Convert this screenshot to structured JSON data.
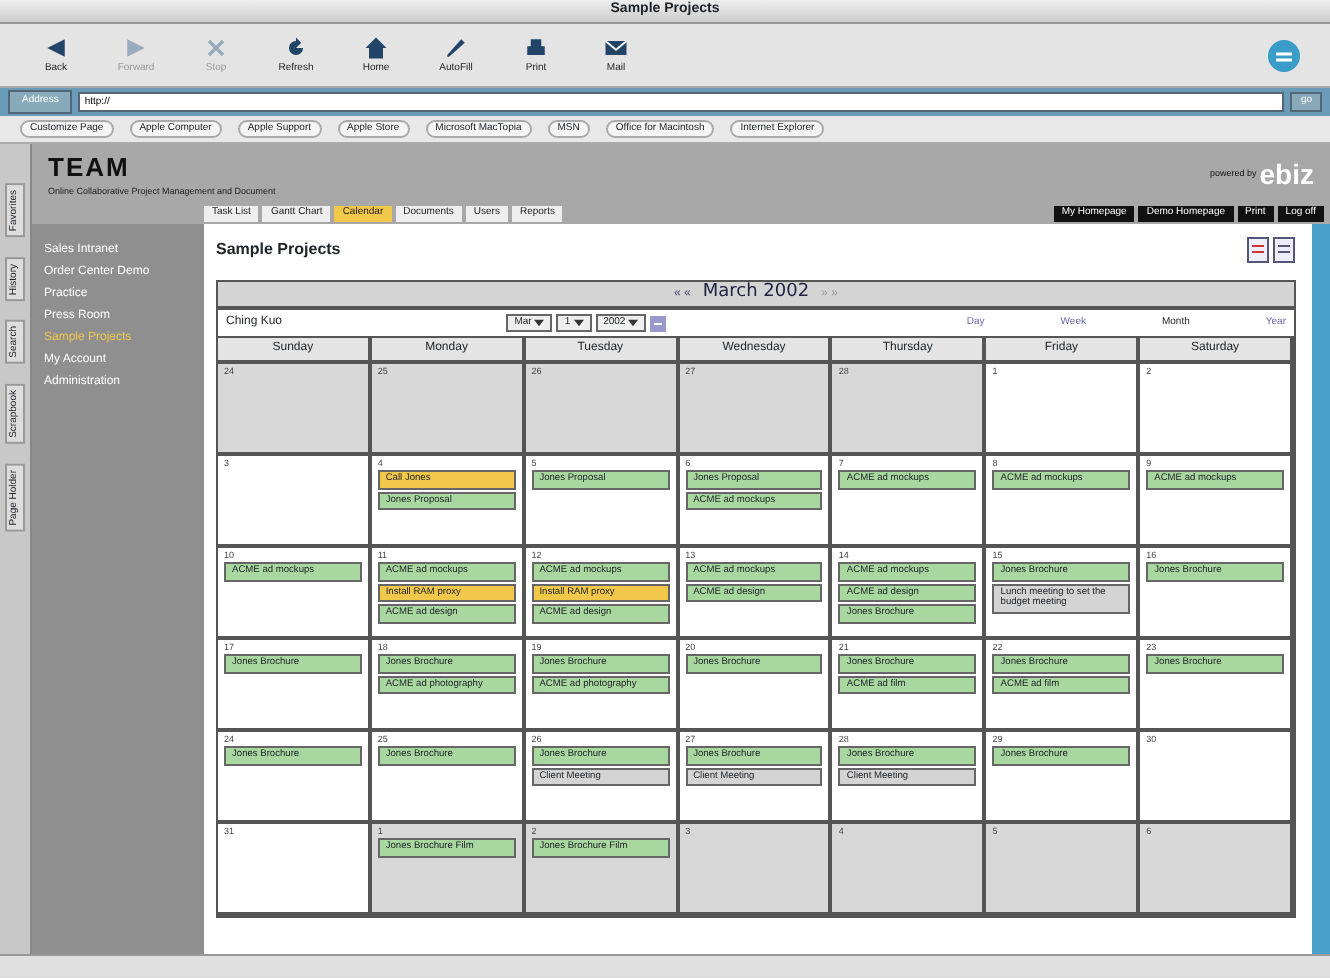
{
  "window": {
    "title": "Sample Projects"
  },
  "toolbar": [
    {
      "label": "Back",
      "disabled": false
    },
    {
      "label": "Forward",
      "disabled": true
    },
    {
      "label": "Stop",
      "disabled": true
    },
    {
      "label": "Refresh",
      "disabled": false
    },
    {
      "label": "Home",
      "disabled": false
    },
    {
      "label": "AutoFill",
      "disabled": false
    },
    {
      "label": "Print",
      "disabled": false
    },
    {
      "label": "Mail",
      "disabled": false
    }
  ],
  "address": {
    "label": "Address",
    "value": "http://",
    "go": "go"
  },
  "favorites": [
    "Customize Page",
    "Apple Computer",
    "Apple Support",
    "Apple Store",
    "Microsoft MacTopia",
    "MSN",
    "Office for Macintosh",
    "Internet Explorer"
  ],
  "explorer_tabs": [
    "Favorites",
    "History",
    "Search",
    "Scrapbook",
    "Page Holder"
  ],
  "header": {
    "logo": "TEAM",
    "tagline": "Online Collaborative Project Management and Document",
    "powered_by": "powered by",
    "brand": "ebiz",
    "links": [
      "My Homepage",
      "Demo Homepage",
      "Print",
      "Log off"
    ]
  },
  "tabs": [
    {
      "label": "Task List",
      "selected": false
    },
    {
      "label": "Gantt Chart",
      "selected": false
    },
    {
      "label": "Calendar",
      "selected": true
    },
    {
      "label": "Documents",
      "selected": false
    },
    {
      "label": "Users",
      "selected": false
    },
    {
      "label": "Reports",
      "selected": false
    }
  ],
  "sidebar": {
    "items": [
      {
        "label": "Sales Intranet",
        "selected": false
      },
      {
        "label": "Order Center Demo",
        "selected": false
      },
      {
        "label": "Practice",
        "selected": false
      },
      {
        "label": "Press Room",
        "selected": false
      },
      {
        "label": "Sample Projects",
        "selected": true
      },
      {
        "label": "My Account",
        "selected": false
      },
      {
        "label": "Administration",
        "selected": false
      }
    ]
  },
  "page_title": "Sample Projects",
  "calendar": {
    "prev": "« «",
    "month": "March 2002",
    "next": "» »",
    "person": "Ching Kuo",
    "month_select": "Mar",
    "day_select": "1",
    "year_select": "2002",
    "views": [
      {
        "label": "Day",
        "selected": false
      },
      {
        "label": "Week",
        "selected": false
      },
      {
        "label": "Month",
        "selected": true
      },
      {
        "label": "Year",
        "selected": false
      }
    ],
    "weekdays": [
      "Sunday",
      "Monday",
      "Tuesday",
      "Wednesday",
      "Thursday",
      "Friday",
      "Saturday"
    ],
    "weeks": [
      [
        {
          "day": "24",
          "in_month": false
        },
        {
          "day": "25",
          "in_month": false
        },
        {
          "day": "26",
          "in_month": false
        },
        {
          "day": "27",
          "in_month": false
        },
        {
          "day": "28",
          "in_month": false
        },
        {
          "day": "1",
          "in_month": true
        },
        {
          "day": "2",
          "in_month": true
        }
      ],
      [
        {
          "day": "3",
          "in_month": true
        },
        {
          "day": "4",
          "in_month": true,
          "events": [
            {
              "title": "Call Jones",
              "color": "#f2c84b"
            },
            {
              "title": "Jones Proposal",
              "color": "#a8d8a0"
            }
          ]
        },
        {
          "day": "5",
          "in_month": true,
          "events": [
            {
              "title": "Jones Proposal",
              "color": "#a8d8a0"
            }
          ]
        },
        {
          "day": "6",
          "in_month": true,
          "events": [
            {
              "title": "Jones Proposal",
              "color": "#a8d8a0"
            },
            {
              "title": "ACME ad mockups",
              "color": "#a8d8a0"
            }
          ]
        },
        {
          "day": "7",
          "in_month": true,
          "events": [
            {
              "title": "ACME ad mockups",
              "color": "#a8d8a0"
            }
          ]
        },
        {
          "day": "8",
          "in_month": true,
          "events": [
            {
              "title": "ACME ad mockups",
              "color": "#a8d8a0"
            }
          ]
        },
        {
          "day": "9",
          "in_month": true,
          "events": [
            {
              "title": "ACME ad mockups",
              "color": "#a8d8a0"
            }
          ]
        }
      ],
      [
        {
          "day": "10",
          "in_month": true,
          "events": [
            {
              "title": "ACME ad mockups",
              "color": "#a8d8a0"
            }
          ]
        },
        {
          "day": "11",
          "in_month": true,
          "events": [
            {
              "title": "ACME ad mockups",
              "color": "#a8d8a0"
            },
            {
              "title": "Install RAM proxy",
              "color": "#f2c84b"
            },
            {
              "title": "ACME ad design",
              "color": "#a8d8a0"
            }
          ]
        },
        {
          "day": "12",
          "in_month": true,
          "events": [
            {
              "title": "ACME ad mockups",
              "color": "#a8d8a0"
            },
            {
              "title": "Install RAM proxy",
              "color": "#f2c84b"
            },
            {
              "title": "ACME ad design",
              "color": "#a8d8a0"
            }
          ]
        },
        {
          "day": "13",
          "in_month": true,
          "events": [
            {
              "title": "ACME ad mockups",
              "color": "#a8d8a0"
            },
            {
              "title": "ACME ad design",
              "color": "#a8d8a0"
            }
          ]
        },
        {
          "day": "14",
          "in_month": true,
          "events": [
            {
              "title": "ACME ad mockups",
              "color": "#a8d8a0"
            },
            {
              "title": "ACME ad design",
              "color": "#a8d8a0"
            },
            {
              "title": "Jones Brochure",
              "color": "#a8d8a0"
            }
          ]
        },
        {
          "day": "15",
          "in_month": true,
          "events": [
            {
              "title": "Jones Brochure",
              "color": "#a8d8a0"
            },
            {
              "title": "Lunch meeting to set the budget meeting",
              "color": "#d4d4d4"
            }
          ]
        },
        {
          "day": "16",
          "in_month": true,
          "events": [
            {
              "title": "Jones Brochure",
              "color": "#a8d8a0"
            }
          ]
        }
      ],
      [
        {
          "day": "17",
          "in_month": true,
          "events": [
            {
              "title": "Jones Brochure",
              "color": "#a8d8a0"
            }
          ]
        },
        {
          "day": "18",
          "in_month": true,
          "events": [
            {
              "title": "Jones Brochure",
              "color": "#a8d8a0"
            },
            {
              "title": "ACME ad photography",
              "color": "#a8d8a0"
            }
          ]
        },
        {
          "day": "19",
          "in_month": true,
          "events": [
            {
              "title": "Jones Brochure",
              "color": "#a8d8a0"
            },
            {
              "title": "ACME ad photography",
              "color": "#a8d8a0"
            }
          ]
        },
        {
          "day": "20",
          "in_month": true,
          "events": [
            {
              "title": "Jones Brochure",
              "color": "#a8d8a0"
            }
          ]
        },
        {
          "day": "21",
          "in_month": true,
          "events": [
            {
              "title": "Jones Brochure",
              "color": "#a8d8a0"
            },
            {
              "title": "ACME ad film",
              "color": "#a8d8a0"
            }
          ]
        },
        {
          "day": "22",
          "in_month": true,
          "events": [
            {
              "title": "Jones Brochure",
              "color": "#a8d8a0"
            },
            {
              "title": "ACME ad film",
              "color": "#a8d8a0"
            }
          ]
        },
        {
          "day": "23",
          "in_month": true,
          "events": [
            {
              "title": "Jones Brochure",
              "color": "#a8d8a0"
            }
          ]
        }
      ],
      [
        {
          "day": "24",
          "in_month": true,
          "events": [
            {
              "title": "Jones Brochure",
              "color": "#a8d8a0"
            }
          ]
        },
        {
          "day": "25",
          "in_month": true,
          "events": [
            {
              "title": "Jones Brochure",
              "color": "#a8d8a0"
            }
          ]
        },
        {
          "day": "26",
          "in_month": true,
          "events": [
            {
              "title": "Jones Brochure",
              "color": "#a8d8a0"
            },
            {
              "title": "Client Meeting",
              "color": "#d4d4d4"
            }
          ]
        },
        {
          "day": "27",
          "in_month": true,
          "events": [
            {
              "title": "Jones Brochure",
              "color": "#a8d8a0"
            },
            {
              "title": "Client Meeting",
              "color": "#d4d4d4"
            }
          ]
        },
        {
          "day": "28",
          "in_month": true,
          "events": [
            {
              "title": "Jones Brochure",
              "color": "#a8d8a0"
            },
            {
              "title": "Client Meeting",
              "color": "#d4d4d4"
            }
          ]
        },
        {
          "day": "29",
          "in_month": true,
          "events": [
            {
              "title": "Jones Brochure",
              "color": "#a8d8a0"
            }
          ]
        },
        {
          "day": "30",
          "in_month": true
        }
      ],
      [
        {
          "day": "31",
          "in_month": true
        },
        {
          "day": "1",
          "in_month": false,
          "events": [
            {
              "title": "Jones Brochure Film",
              "color": "#a8d8a0"
            }
          ]
        },
        {
          "day": "2",
          "in_month": false,
          "events": [
            {
              "title": "Jones Brochure Film",
              "color": "#a8d8a0"
            }
          ]
        },
        {
          "day": "3",
          "in_month": false
        },
        {
          "day": "4",
          "in_month": false
        },
        {
          "day": "5",
          "in_month": false
        },
        {
          "day": "6",
          "in_month": false
        }
      ]
    ]
  }
}
